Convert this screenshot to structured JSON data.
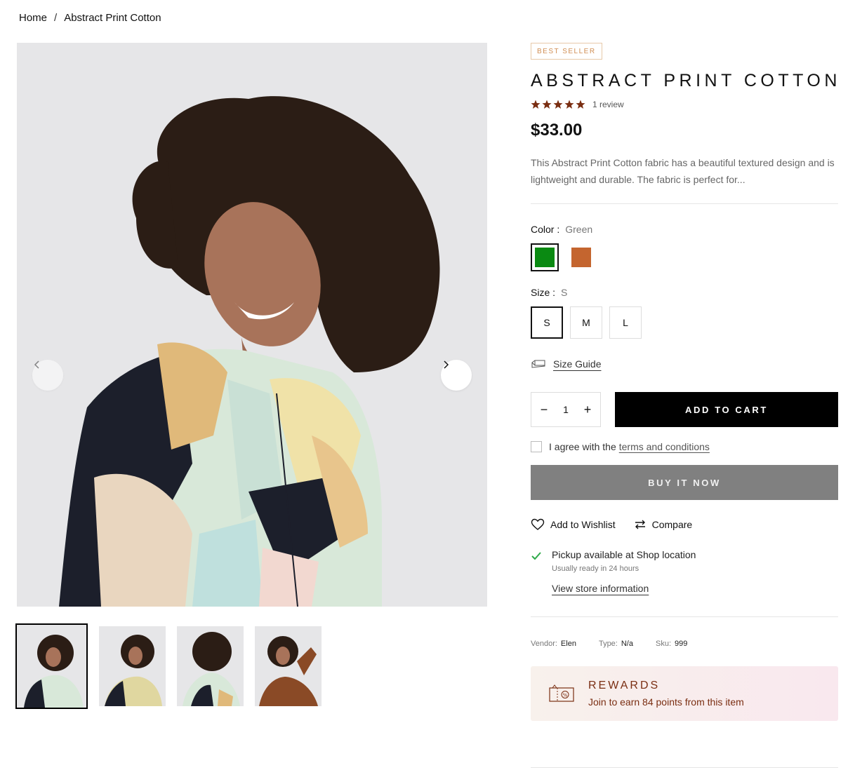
{
  "breadcrumb": {
    "home": "Home",
    "separator": "/",
    "current": "Abstract Print Cotton"
  },
  "product": {
    "badge": "BEST SELLER",
    "title": "ABSTRACT PRINT COTTON",
    "rating": 5,
    "review_count": "1 review",
    "price": "$33.00",
    "description": "This Abstract Print Cotton fabric has a beautiful textured design and is lightweight and durable. The fabric is perfect for...",
    "star_color": "#7a2e12"
  },
  "color": {
    "label": "Color :",
    "selected": "Green",
    "swatches": [
      {
        "name": "Green",
        "hex": "#0a8a12"
      },
      {
        "name": "Copper",
        "hex": "#c4652f"
      }
    ]
  },
  "size": {
    "label": "Size :",
    "selected": "S",
    "options": [
      "S",
      "M",
      "L"
    ]
  },
  "size_guide": {
    "label": "Size Guide",
    "icon": "ruler-icon"
  },
  "cart": {
    "quantity": "1",
    "minus": "−",
    "plus": "+",
    "add_to_cart": "ADD TO CART"
  },
  "agree": {
    "text": "I agree with the",
    "link": "terms and conditions"
  },
  "buy_now": "BUY IT NOW",
  "actions": {
    "wishlist": "Add to Wishlist",
    "compare": "Compare"
  },
  "pickup": {
    "main": "Pickup available at Shop location",
    "sub": "Usually ready in 24 hours",
    "link": "View store information"
  },
  "meta": {
    "vendor_label": "Vendor:",
    "vendor": "Elen",
    "type_label": "Type:",
    "type": "N/a",
    "sku_label": "Sku:",
    "sku": "999"
  },
  "rewards": {
    "title": "REWARDS",
    "subtitle": "Join to earn 84 points from this item"
  }
}
